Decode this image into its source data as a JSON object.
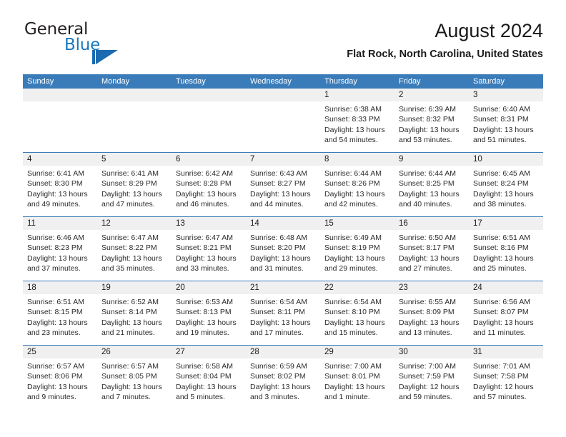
{
  "brand": {
    "name_part1": "General",
    "name_part2": "Blue",
    "mark": "triangle-flag-logo"
  },
  "header": {
    "title": "August 2024",
    "location": "Flat Rock, North Carolina, United States"
  },
  "colors": {
    "header_blue": "#3a7cb9",
    "brand_blue": "#1878be",
    "date_strip": "#f0f0f0",
    "text": "#2b2b2b"
  },
  "weekdays": [
    "Sunday",
    "Monday",
    "Tuesday",
    "Wednesday",
    "Thursday",
    "Friday",
    "Saturday"
  ],
  "weeks": [
    {
      "days": [
        {
          "date": "",
          "empty": true
        },
        {
          "date": "",
          "empty": true
        },
        {
          "date": "",
          "empty": true
        },
        {
          "date": "",
          "empty": true
        },
        {
          "date": "1",
          "sunrise": "Sunrise: 6:38 AM",
          "sunset": "Sunset: 8:33 PM",
          "daylight_1": "Daylight: 13 hours",
          "daylight_2": "and 54 minutes."
        },
        {
          "date": "2",
          "sunrise": "Sunrise: 6:39 AM",
          "sunset": "Sunset: 8:32 PM",
          "daylight_1": "Daylight: 13 hours",
          "daylight_2": "and 53 minutes."
        },
        {
          "date": "3",
          "sunrise": "Sunrise: 6:40 AM",
          "sunset": "Sunset: 8:31 PM",
          "daylight_1": "Daylight: 13 hours",
          "daylight_2": "and 51 minutes."
        }
      ]
    },
    {
      "days": [
        {
          "date": "4",
          "sunrise": "Sunrise: 6:41 AM",
          "sunset": "Sunset: 8:30 PM",
          "daylight_1": "Daylight: 13 hours",
          "daylight_2": "and 49 minutes."
        },
        {
          "date": "5",
          "sunrise": "Sunrise: 6:41 AM",
          "sunset": "Sunset: 8:29 PM",
          "daylight_1": "Daylight: 13 hours",
          "daylight_2": "and 47 minutes."
        },
        {
          "date": "6",
          "sunrise": "Sunrise: 6:42 AM",
          "sunset": "Sunset: 8:28 PM",
          "daylight_1": "Daylight: 13 hours",
          "daylight_2": "and 46 minutes."
        },
        {
          "date": "7",
          "sunrise": "Sunrise: 6:43 AM",
          "sunset": "Sunset: 8:27 PM",
          "daylight_1": "Daylight: 13 hours",
          "daylight_2": "and 44 minutes."
        },
        {
          "date": "8",
          "sunrise": "Sunrise: 6:44 AM",
          "sunset": "Sunset: 8:26 PM",
          "daylight_1": "Daylight: 13 hours",
          "daylight_2": "and 42 minutes."
        },
        {
          "date": "9",
          "sunrise": "Sunrise: 6:44 AM",
          "sunset": "Sunset: 8:25 PM",
          "daylight_1": "Daylight: 13 hours",
          "daylight_2": "and 40 minutes."
        },
        {
          "date": "10",
          "sunrise": "Sunrise: 6:45 AM",
          "sunset": "Sunset: 8:24 PM",
          "daylight_1": "Daylight: 13 hours",
          "daylight_2": "and 38 minutes."
        }
      ]
    },
    {
      "days": [
        {
          "date": "11",
          "sunrise": "Sunrise: 6:46 AM",
          "sunset": "Sunset: 8:23 PM",
          "daylight_1": "Daylight: 13 hours",
          "daylight_2": "and 37 minutes."
        },
        {
          "date": "12",
          "sunrise": "Sunrise: 6:47 AM",
          "sunset": "Sunset: 8:22 PM",
          "daylight_1": "Daylight: 13 hours",
          "daylight_2": "and 35 minutes."
        },
        {
          "date": "13",
          "sunrise": "Sunrise: 6:47 AM",
          "sunset": "Sunset: 8:21 PM",
          "daylight_1": "Daylight: 13 hours",
          "daylight_2": "and 33 minutes."
        },
        {
          "date": "14",
          "sunrise": "Sunrise: 6:48 AM",
          "sunset": "Sunset: 8:20 PM",
          "daylight_1": "Daylight: 13 hours",
          "daylight_2": "and 31 minutes."
        },
        {
          "date": "15",
          "sunrise": "Sunrise: 6:49 AM",
          "sunset": "Sunset: 8:19 PM",
          "daylight_1": "Daylight: 13 hours",
          "daylight_2": "and 29 minutes."
        },
        {
          "date": "16",
          "sunrise": "Sunrise: 6:50 AM",
          "sunset": "Sunset: 8:17 PM",
          "daylight_1": "Daylight: 13 hours",
          "daylight_2": "and 27 minutes."
        },
        {
          "date": "17",
          "sunrise": "Sunrise: 6:51 AM",
          "sunset": "Sunset: 8:16 PM",
          "daylight_1": "Daylight: 13 hours",
          "daylight_2": "and 25 minutes."
        }
      ]
    },
    {
      "days": [
        {
          "date": "18",
          "sunrise": "Sunrise: 6:51 AM",
          "sunset": "Sunset: 8:15 PM",
          "daylight_1": "Daylight: 13 hours",
          "daylight_2": "and 23 minutes."
        },
        {
          "date": "19",
          "sunrise": "Sunrise: 6:52 AM",
          "sunset": "Sunset: 8:14 PM",
          "daylight_1": "Daylight: 13 hours",
          "daylight_2": "and 21 minutes."
        },
        {
          "date": "20",
          "sunrise": "Sunrise: 6:53 AM",
          "sunset": "Sunset: 8:13 PM",
          "daylight_1": "Daylight: 13 hours",
          "daylight_2": "and 19 minutes."
        },
        {
          "date": "21",
          "sunrise": "Sunrise: 6:54 AM",
          "sunset": "Sunset: 8:11 PM",
          "daylight_1": "Daylight: 13 hours",
          "daylight_2": "and 17 minutes."
        },
        {
          "date": "22",
          "sunrise": "Sunrise: 6:54 AM",
          "sunset": "Sunset: 8:10 PM",
          "daylight_1": "Daylight: 13 hours",
          "daylight_2": "and 15 minutes."
        },
        {
          "date": "23",
          "sunrise": "Sunrise: 6:55 AM",
          "sunset": "Sunset: 8:09 PM",
          "daylight_1": "Daylight: 13 hours",
          "daylight_2": "and 13 minutes."
        },
        {
          "date": "24",
          "sunrise": "Sunrise: 6:56 AM",
          "sunset": "Sunset: 8:07 PM",
          "daylight_1": "Daylight: 13 hours",
          "daylight_2": "and 11 minutes."
        }
      ]
    },
    {
      "days": [
        {
          "date": "25",
          "sunrise": "Sunrise: 6:57 AM",
          "sunset": "Sunset: 8:06 PM",
          "daylight_1": "Daylight: 13 hours",
          "daylight_2": "and 9 minutes."
        },
        {
          "date": "26",
          "sunrise": "Sunrise: 6:57 AM",
          "sunset": "Sunset: 8:05 PM",
          "daylight_1": "Daylight: 13 hours",
          "daylight_2": "and 7 minutes."
        },
        {
          "date": "27",
          "sunrise": "Sunrise: 6:58 AM",
          "sunset": "Sunset: 8:04 PM",
          "daylight_1": "Daylight: 13 hours",
          "daylight_2": "and 5 minutes."
        },
        {
          "date": "28",
          "sunrise": "Sunrise: 6:59 AM",
          "sunset": "Sunset: 8:02 PM",
          "daylight_1": "Daylight: 13 hours",
          "daylight_2": "and 3 minutes."
        },
        {
          "date": "29",
          "sunrise": "Sunrise: 7:00 AM",
          "sunset": "Sunset: 8:01 PM",
          "daylight_1": "Daylight: 13 hours",
          "daylight_2": "and 1 minute."
        },
        {
          "date": "30",
          "sunrise": "Sunrise: 7:00 AM",
          "sunset": "Sunset: 7:59 PM",
          "daylight_1": "Daylight: 12 hours",
          "daylight_2": "and 59 minutes."
        },
        {
          "date": "31",
          "sunrise": "Sunrise: 7:01 AM",
          "sunset": "Sunset: 7:58 PM",
          "daylight_1": "Daylight: 12 hours",
          "daylight_2": "and 57 minutes."
        }
      ]
    }
  ]
}
